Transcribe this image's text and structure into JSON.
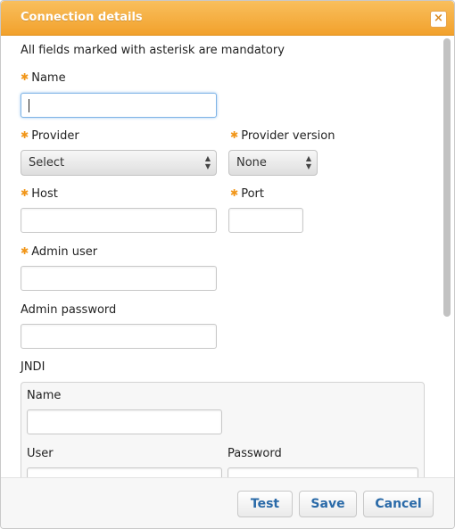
{
  "dialog": {
    "title": "Connection details",
    "close_label": "×",
    "mandatory_note": "All fields marked with asterisk are mandatory"
  },
  "fields": {
    "name": {
      "label": "Name",
      "value": ""
    },
    "provider": {
      "label": "Provider",
      "selected": "Select"
    },
    "provider_version": {
      "label": "Provider version",
      "selected": "None"
    },
    "host": {
      "label": "Host",
      "value": ""
    },
    "port": {
      "label": "Port",
      "value": ""
    },
    "admin_user": {
      "label": "Admin user",
      "value": ""
    },
    "admin_password": {
      "label": "Admin password",
      "value": ""
    }
  },
  "jndi": {
    "title": "JNDI",
    "name_label": "Name",
    "user_label": "User",
    "password_label": "Password"
  },
  "footer": {
    "test_label": "Test",
    "save_label": "Save",
    "cancel_label": "Cancel"
  },
  "icons": {
    "required": "✱",
    "select_arrows": "▲▼"
  },
  "colors": {
    "titlebar": "#f2a12c",
    "required_star": "#f19619",
    "button_text": "#2a6aa8"
  }
}
